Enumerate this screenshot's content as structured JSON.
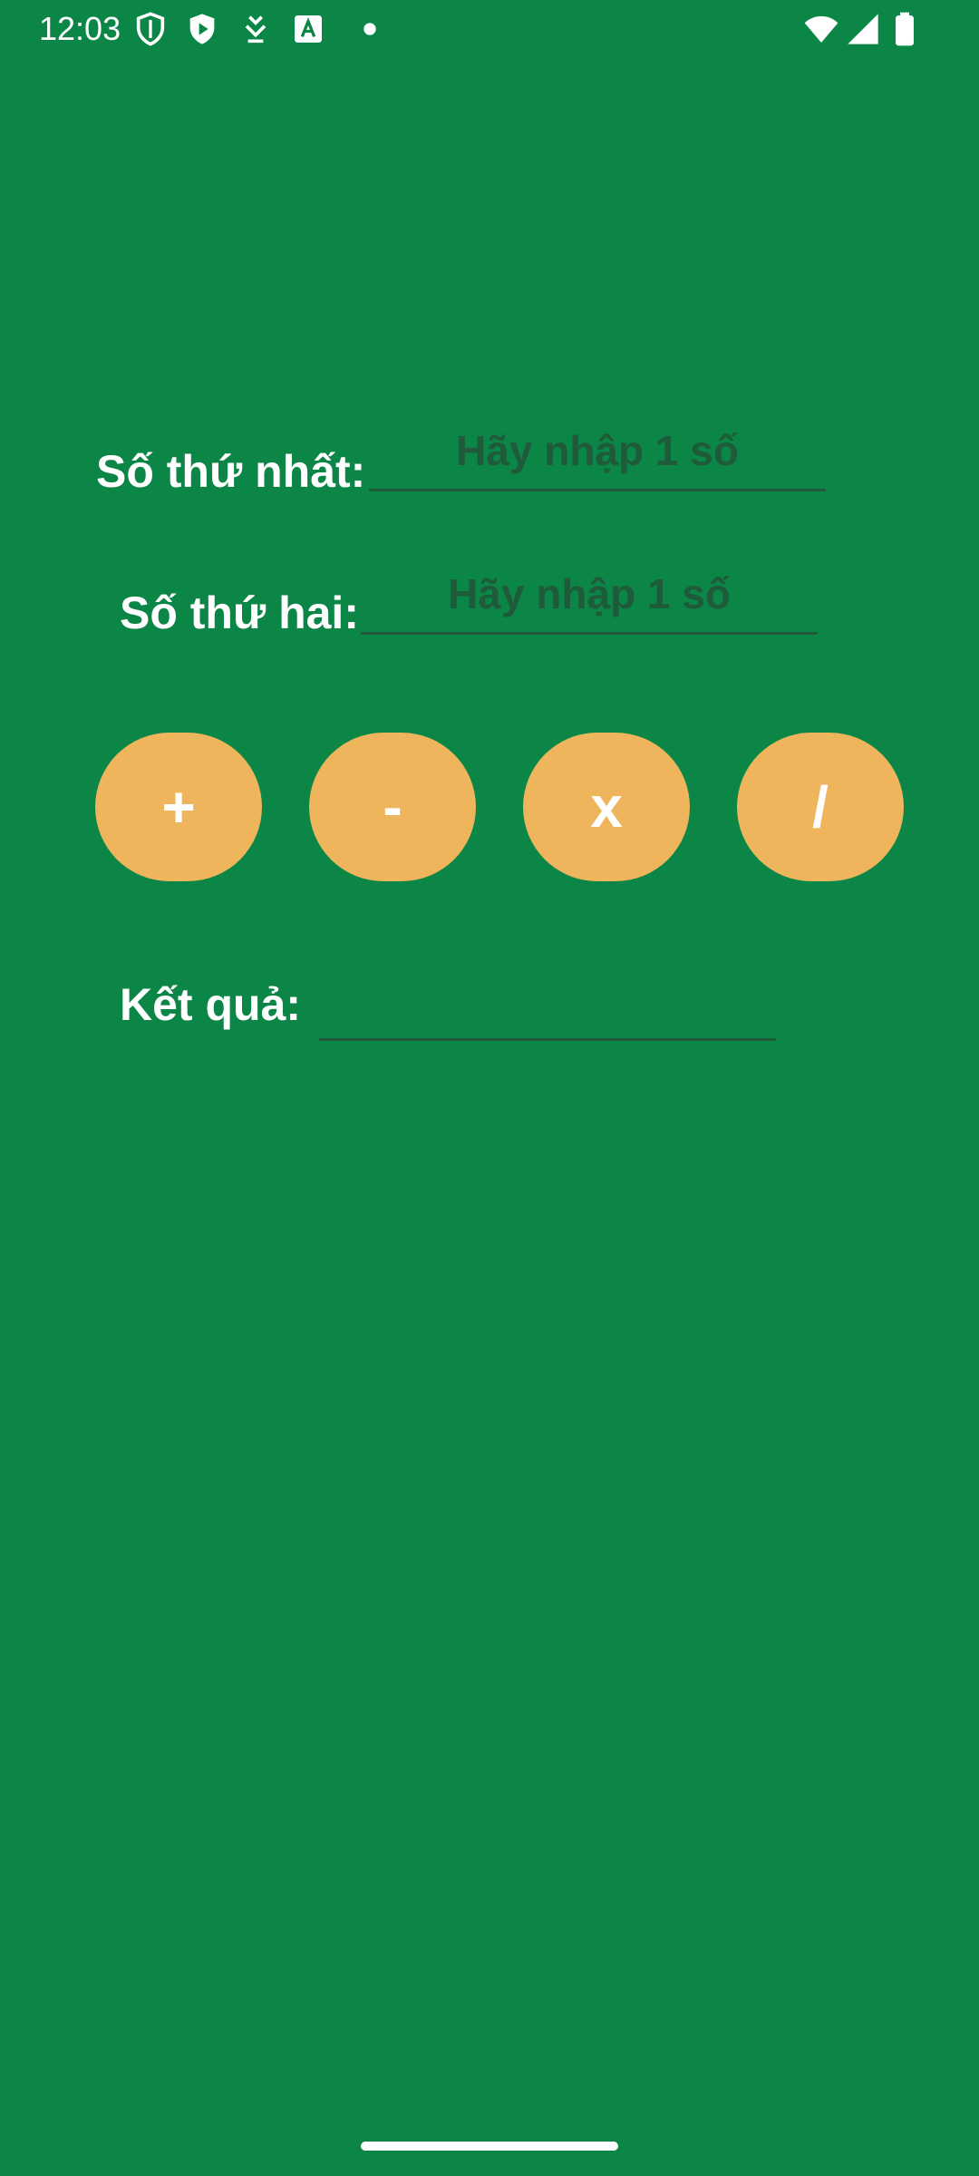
{
  "status_bar": {
    "time": "12:03",
    "left_icons": [
      "shield-outline-icon",
      "shield-play-icon",
      "download-arrow-icon",
      "font-a-icon",
      "dot-icon"
    ],
    "right_icons": [
      "wifi-icon",
      "cellular-signal-icon",
      "battery-icon"
    ]
  },
  "form": {
    "first_number": {
      "label": "Số thứ nhất:",
      "value": "",
      "placeholder": "Hãy nhập 1 số"
    },
    "second_number": {
      "label": "Số thứ hai:",
      "value": "",
      "placeholder": "Hãy nhập 1 số"
    }
  },
  "operations": {
    "add_label": "+",
    "subtract_label": "-",
    "multiply_label": "x",
    "divide_label": "/"
  },
  "result": {
    "label": "Kết quả:",
    "value": ""
  },
  "colors": {
    "background": "#0b8646",
    "button": "#efb55c",
    "hint_text": "#1f5a3a",
    "label_text": "#ffffff"
  }
}
